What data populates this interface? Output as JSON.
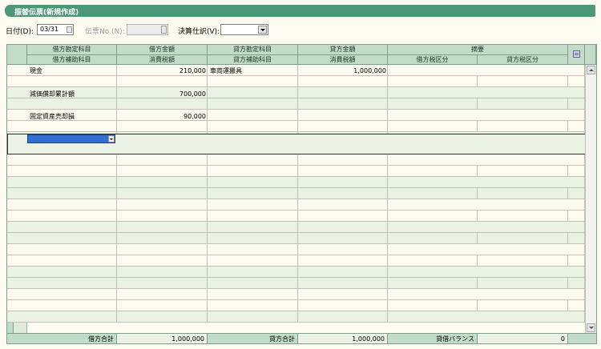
{
  "title": "振替伝票(新規作成)",
  "toolbar": {
    "date_label": "日付(D):",
    "date_value": "03/31",
    "voucher_no_label": "伝票No.(N):",
    "settlement_label": "決算仕訳(V):",
    "settlement_value": ""
  },
  "headers": {
    "top": [
      "借方勘定科目",
      "借方金額",
      "貸方勘定科目",
      "貸方金額",
      "摘要"
    ],
    "bottom": [
      "借方補助科目",
      "消費税額",
      "貸方補助科目",
      "消費税額",
      "借方税区分",
      "貸方税区分"
    ]
  },
  "entries": [
    {
      "debit_account": "現金",
      "debit_amount": "210,000",
      "credit_account": "車両運搬具",
      "credit_amount": "1,000,000"
    },
    {
      "debit_account": "減価償却累計額",
      "debit_amount": "700,000",
      "credit_account": "",
      "credit_amount": ""
    },
    {
      "debit_account": "固定資産売却損",
      "debit_amount": "90,000",
      "credit_account": "",
      "credit_amount": ""
    }
  ],
  "footer": {
    "debit_total_label": "借方合計",
    "debit_total": "1,000,000",
    "credit_total_label": "貸方合計",
    "credit_total": "1,000,000",
    "balance_label": "貸借バランス",
    "balance": "0"
  },
  "icons": {
    "memo": "memo-icon",
    "dropdown": "chevron-down-icon",
    "spin": "spin-icon",
    "scroll_up": "scroll-up-icon",
    "scroll_down": "scroll-down-icon"
  },
  "colors": {
    "titlebar": "#4d9779",
    "header_bg": "#c3dcc8",
    "row_alt": "#eaf2e4",
    "row_base": "#fdfbef",
    "selection": "#2f6fd6"
  }
}
